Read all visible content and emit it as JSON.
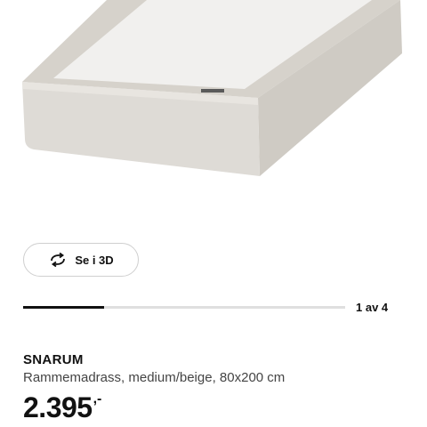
{
  "gallery": {
    "image_alt": "SNARUM Rammemadrass",
    "view_3d_label": "Se i 3D",
    "view_3d_icon": "rotate-3d-icon",
    "counter": "1 av 4",
    "progress_fraction": 0.25
  },
  "product": {
    "name": "SNARUM",
    "description": "Rammemadrass, medium/beige, 80x200 cm",
    "price": "2.395",
    "price_suffix": ",-"
  },
  "colors": {
    "text": "#111111",
    "secondary_text": "#444444",
    "track": "#dfdfdf",
    "mattress": "#d9d6d0"
  }
}
